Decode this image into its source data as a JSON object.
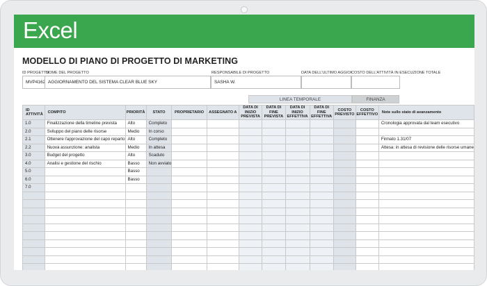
{
  "app": {
    "name": "Excel",
    "brand_color": "#3aa64d"
  },
  "document": {
    "title": "MODELLO DI PIANO DI PROGETTO DI MARKETING"
  },
  "project_info": {
    "labels": {
      "project_id": "ID PROGETTO",
      "project_name": "NOME DEL PROGETTO",
      "manager": "RESPONSABILE DI PROGETTO",
      "last_update": "DATA DELL'ULTIMO AGGIORNAMENTO",
      "total_cost": "COSTO DELL'ATTIVITÀ IN ESECUZIONE TOTALE"
    },
    "values": {
      "project_id": "MVP4162",
      "project_name": "AGGIORNAMENTO DEL SISTEMA CLEAR BLUE SKY",
      "manager": "SASHA W.",
      "last_update": "",
      "total_cost": ""
    }
  },
  "column_groups": {
    "timeline": "LINEA TEMPORALE",
    "finance": "FINANZA"
  },
  "columns": {
    "id": "ID ATTIVITÀ",
    "task": "COMPITO",
    "priority": "PRIORITÀ",
    "status": "STATO",
    "owner": "PROPRIETARIO",
    "assigned": "ASSEGNATO A",
    "planned_start": "DATA DI INIZIO PREVISTA",
    "planned_end": "DATA DI FINE PREVISTA",
    "actual_start": "DATA DI INIZIO EFFETTIVA",
    "actual_end": "DATA DI FINE EFFETTIVA",
    "planned_cost": "COSTO PREVISTO",
    "actual_cost": "COSTO EFFETTIVO",
    "notes": "Note sullo stato di avanzamento"
  },
  "rows": [
    {
      "id": "1.0",
      "task": "Finalizzazione della timeline prevista",
      "priority": "Alto",
      "status": "Completo",
      "notes": "Cronologia approvata dal team esecutivo"
    },
    {
      "id": "2.0",
      "task": "Sviluppo del piano delle risorse",
      "priority": "Medio",
      "status": "In corso",
      "notes": ""
    },
    {
      "id": "2.1",
      "task": "Ottenere l'approvazione del capo reparto",
      "priority": "Alto",
      "status": "Completo",
      "notes": "Firmato 1.31/07"
    },
    {
      "id": "2.2",
      "task": "Nuova assunzione: analista",
      "priority": "Medio",
      "status": "In attesa",
      "notes": "Attesa: in attesa di revisione delle risorse umane"
    },
    {
      "id": "3.0",
      "task": "Budget del progetto",
      "priority": "Alto",
      "status": "Scaduto",
      "notes": ""
    },
    {
      "id": "4.0",
      "task": "Analisi e gestione del rischio",
      "priority": "Basso",
      "status": "Non avviato",
      "notes": ""
    },
    {
      "id": "5.0",
      "task": "",
      "priority": "Basso",
      "status": "",
      "notes": ""
    },
    {
      "id": "6.0",
      "task": "",
      "priority": "Basso",
      "status": "",
      "notes": ""
    },
    {
      "id": "7.0",
      "task": "",
      "priority": "",
      "status": "",
      "notes": ""
    }
  ]
}
